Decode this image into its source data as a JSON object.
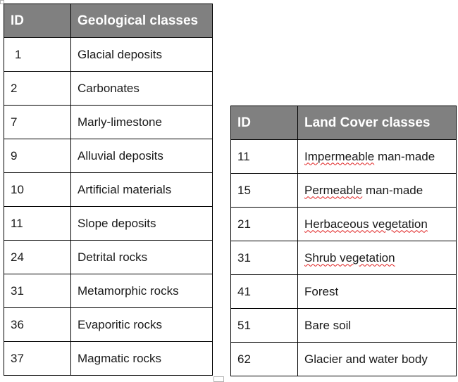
{
  "geological_table": {
    "headers": {
      "id": "ID",
      "name": "Geological classes"
    },
    "rows": [
      {
        "id": "1",
        "name": "Glacial deposits"
      },
      {
        "id": "2",
        "name": "Carbonates"
      },
      {
        "id": "7",
        "name": "Marly-limestone"
      },
      {
        "id": "9",
        "name": "Alluvial deposits"
      },
      {
        "id": "10",
        "name": "Artificial materials"
      },
      {
        "id": "11",
        "name": "Slope deposits"
      },
      {
        "id": "24",
        "name": "Detrital rocks"
      },
      {
        "id": "31",
        "name": "Metamorphic rocks"
      },
      {
        "id": "36",
        "name": "Evaporitic rocks"
      },
      {
        "id": "37",
        "name": "Magmatic rocks"
      }
    ]
  },
  "land_cover_table": {
    "headers": {
      "id": "ID",
      "name": "Land Cover classes"
    },
    "rows": [
      {
        "id": "11",
        "name_parts": [
          "Impermeable",
          " man-made"
        ],
        "spell_flag": "first"
      },
      {
        "id": "15",
        "name_parts": [
          "Permeable",
          " man-made"
        ],
        "spell_flag": "first"
      },
      {
        "id": "21",
        "name_parts": [
          "Herbaceous vegetation",
          ""
        ],
        "spell_flag": "first"
      },
      {
        "id": "31",
        "name_parts": [
          "Shrub vegetation",
          ""
        ],
        "spell_flag": "first"
      },
      {
        "id": "41",
        "name_parts": [
          "",
          "Forest"
        ],
        "spell_flag": "none"
      },
      {
        "id": "51",
        "name_parts": [
          "",
          "Bare soil"
        ],
        "spell_flag": "none"
      },
      {
        "id": "62",
        "name_parts": [
          "",
          "Glacier and water body"
        ],
        "spell_flag": "none"
      }
    ]
  },
  "colors": {
    "header_bg": "#808080",
    "header_text": "#ffffff",
    "spellcheck": "#e02020"
  }
}
